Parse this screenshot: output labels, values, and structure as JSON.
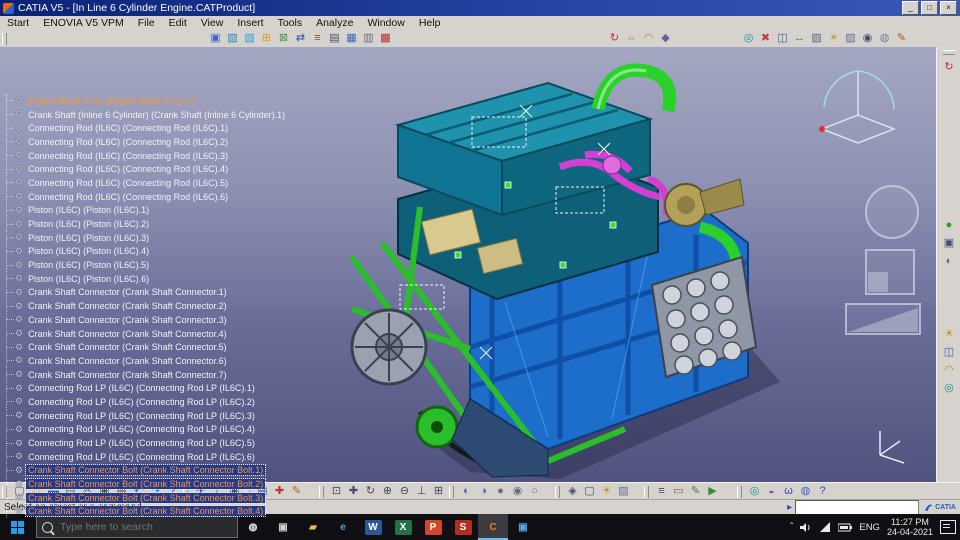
{
  "window": {
    "title": "CATIA V5 - [In Line 6 Cylinder Engine.CATProduct]",
    "controls": [
      {
        "name": "minimize-button",
        "glyph": "_"
      },
      {
        "name": "maximize-button",
        "glyph": "□"
      },
      {
        "name": "close-button",
        "glyph": "×"
      }
    ]
  },
  "menu": {
    "items": [
      "Start",
      "ENOVIA V5 VPM",
      "File",
      "Edit",
      "View",
      "Insert",
      "Tools",
      "Analyze",
      "Window",
      "Help"
    ]
  },
  "toolbar_top": {
    "group1": [
      {
        "name": "component-icon",
        "glyph": "▣",
        "color": "#3a66c8"
      },
      {
        "name": "product-icon",
        "glyph": "▧",
        "color": "#2f87c0"
      },
      {
        "name": "part-icon",
        "glyph": "▨",
        "color": "#2aa0d8"
      },
      {
        "name": "existing-component-icon",
        "glyph": "⊞",
        "color": "#d89a20"
      },
      {
        "name": "existing-component-positioned-icon",
        "glyph": "⊠",
        "color": "#3f9a40"
      },
      {
        "name": "replace-component-icon",
        "glyph": "⇄",
        "color": "#2850b8"
      },
      {
        "name": "graph-tree-reordering-icon",
        "glyph": "≡",
        "color": "#7a5a20"
      },
      {
        "name": "generate-numbering-icon",
        "glyph": "▤",
        "color": "#48506a"
      },
      {
        "name": "selective-load-icon",
        "glyph": "▦",
        "color": "#3a66c8"
      },
      {
        "name": "manage-representations-icon",
        "glyph": "▥",
        "color": "#6a7080"
      },
      {
        "name": "multi-instantiation-icon",
        "glyph": "▩",
        "color": "#b83030"
      }
    ],
    "group2": [
      {
        "name": "update-icon",
        "glyph": "↻",
        "color": "#c03030"
      },
      {
        "name": "measure-between-icon",
        "glyph": "⇔",
        "color": "#b08820"
      },
      {
        "name": "measure-item-icon",
        "glyph": "◠",
        "color": "#b08820"
      },
      {
        "name": "mass-properties-icon",
        "glyph": "◆",
        "color": "#705aa8"
      }
    ],
    "group3": [
      {
        "name": "catalog-browser-icon",
        "glyph": "◎",
        "color": "#17939b"
      },
      {
        "name": "clash-analysis-icon",
        "glyph": "✖",
        "color": "#c04040"
      },
      {
        "name": "sectioning-icon",
        "glyph": "◫",
        "color": "#4060b0"
      },
      {
        "name": "distance-band-icon",
        "glyph": "↔",
        "color": "#3a8a3a"
      },
      {
        "name": "camera-icon",
        "glyph": "▧",
        "color": "#606880"
      },
      {
        "name": "lighting-icon",
        "glyph": "☀",
        "color": "#c8a020"
      },
      {
        "name": "depth-effect-icon",
        "glyph": "▨",
        "color": "#607090"
      },
      {
        "name": "magnifier-icon",
        "glyph": "◉",
        "color": "#405068"
      },
      {
        "name": "x-ray-icon",
        "glyph": "◍",
        "color": "#708098"
      },
      {
        "name": "annotations-icon",
        "glyph": "✎",
        "color": "#b06020"
      }
    ]
  },
  "tree": {
    "items": [
      {
        "label": "Engine Block 6 Cy. (Engine Block 6 Cy..1)",
        "state": "orange"
      },
      {
        "label": "Crank Shaft (Inline 6 Cylinder) (Crank Shaft (Inline 6 Cylinder).1)",
        "state": "normal"
      },
      {
        "label": "Connecting Rod (IL6C) (Connecting Rod (IL6C).1)",
        "state": "normal"
      },
      {
        "label": "Connecting Rod (IL6C) (Connecting Rod (IL6C).2)",
        "state": "normal"
      },
      {
        "label": "Connecting Rod (IL6C) (Connecting Rod (IL6C).3)",
        "state": "normal"
      },
      {
        "label": "Connecting Rod (IL6C) (Connecting Rod (IL6C).4)",
        "state": "normal"
      },
      {
        "label": "Connecting Rod (IL6C) (Connecting Rod (IL6C).5)",
        "state": "normal"
      },
      {
        "label": "Connecting Rod (IL6C) (Connecting Rod (IL6C).6)",
        "state": "normal"
      },
      {
        "label": "Piston (IL6C) (Piston (IL6C).1)",
        "state": "normal"
      },
      {
        "label": "Piston (IL6C) (Piston (IL6C).2)",
        "state": "normal"
      },
      {
        "label": "Piston (IL6C) (Piston (IL6C).3)",
        "state": "normal"
      },
      {
        "label": "Piston (IL6C) (Piston (IL6C).4)",
        "state": "normal"
      },
      {
        "label": "Piston (IL6C) (Piston (IL6C).5)",
        "state": "normal"
      },
      {
        "label": "Piston (IL6C) (Piston (IL6C).6)",
        "state": "normal"
      },
      {
        "label": "Crank Shaft Connector (Crank Shaft Connector.1)",
        "state": "normal"
      },
      {
        "label": "Crank Shaft Connector (Crank Shaft Connector.2)",
        "state": "normal"
      },
      {
        "label": "Crank Shaft Connector (Crank Shaft Connector.3)",
        "state": "normal"
      },
      {
        "label": "Crank Shaft Connector (Crank Shaft Connector.4)",
        "state": "normal"
      },
      {
        "label": "Crank Shaft Connector (Crank Shaft Connector.5)",
        "state": "normal"
      },
      {
        "label": "Crank Shaft Connector (Crank Shaft Connector.6)",
        "state": "normal"
      },
      {
        "label": "Crank Shaft Connector (Crank Shaft Connector.7)",
        "state": "normal"
      },
      {
        "label": "Connecting Rod LP (IL6C) (Connecting Rod LP (IL6C).1)",
        "state": "normal"
      },
      {
        "label": "Connecting Rod LP (IL6C) (Connecting Rod LP (IL6C).2)",
        "state": "normal"
      },
      {
        "label": "Connecting Rod LP (IL6C) (Connecting Rod LP (IL6C).3)",
        "state": "normal"
      },
      {
        "label": "Connecting Rod LP (IL6C) (Connecting Rod LP (IL6C).4)",
        "state": "normal"
      },
      {
        "label": "Connecting Rod LP (IL6C) (Connecting Rod LP (IL6C).5)",
        "state": "normal"
      },
      {
        "label": "Connecting Rod LP (IL6C) (Connecting Rod LP (IL6C).6)",
        "state": "normal"
      },
      {
        "label": "Crank Shaft Connector Bolt (Crank Shaft Connector Bolt.1)",
        "state": "selected"
      },
      {
        "label": "Crank Shaft Connector Bolt (Crank Shaft Connector Bolt.2)",
        "state": "selected"
      },
      {
        "label": "Crank Shaft Connector Bolt (Crank Shaft Connector Bolt.3)",
        "state": "selected"
      },
      {
        "label": "Crank Shaft Connector Bolt (Crank Shaft Connector Bolt.4)",
        "state": "selected"
      }
    ]
  },
  "toolbar_bottom": {
    "groupA": [
      {
        "name": "new-document-icon",
        "glyph": "▢",
        "color": "#506080"
      },
      {
        "name": "open-icon",
        "glyph": "▱",
        "color": "#d8a020"
      },
      {
        "name": "save-icon",
        "glyph": "▬",
        "color": "#3050a0"
      },
      {
        "name": "print-icon",
        "glyph": "▤",
        "color": "#607080"
      },
      {
        "name": "cut-icon",
        "glyph": "✂",
        "color": "#505050"
      },
      {
        "name": "copy-icon",
        "glyph": "▣",
        "color": "#505050"
      },
      {
        "name": "paste-icon",
        "glyph": "▩",
        "color": "#7a5a30"
      },
      {
        "name": "undo-icon",
        "glyph": "↶",
        "color": "#2850b8"
      },
      {
        "name": "redo-icon",
        "glyph": "↷",
        "color": "#2850b8"
      },
      {
        "name": "help-icon",
        "glyph": "?",
        "color": "#2850b8"
      }
    ],
    "groupB": [
      {
        "name": "fly-mode-icon",
        "glyph": "✈",
        "color": "#3a5ac0"
      },
      {
        "name": "knowledge-fx-icon",
        "glyph": "ƒ",
        "color": "#987a18"
      },
      {
        "name": "search-icon",
        "glyph": "◉",
        "color": "#405068"
      }
    ],
    "groupC": [
      {
        "name": "grid-icon",
        "glyph": "▦",
        "color": "#3a66c8"
      },
      {
        "name": "axis-system-icon",
        "glyph": "✚",
        "color": "#c03030"
      },
      {
        "name": "sketcher-icon",
        "glyph": "✎",
        "color": "#b06020"
      }
    ],
    "groupD": [
      {
        "name": "fit-all-in-icon",
        "glyph": "⊡",
        "color": "#404a60"
      },
      {
        "name": "pan-icon",
        "glyph": "✚",
        "color": "#404a60"
      },
      {
        "name": "rotate-icon",
        "glyph": "↻",
        "color": "#404a60"
      },
      {
        "name": "zoom-in-icon",
        "glyph": "⊕",
        "color": "#404a60"
      },
      {
        "name": "zoom-out-icon",
        "glyph": "⊖",
        "color": "#404a60"
      },
      {
        "name": "normal-view-icon",
        "glyph": "⊥",
        "color": "#404a60"
      },
      {
        "name": "multi-view-icon",
        "glyph": "⊞",
        "color": "#404a60"
      }
    ],
    "groupE": [
      {
        "name": "hide-show-icon",
        "glyph": "◐",
        "color": "#3a66c8"
      },
      {
        "name": "swap-visible-space-icon",
        "glyph": "◑",
        "color": "#3a66c8"
      },
      {
        "name": "shading-icon",
        "glyph": "●",
        "color": "#607080"
      },
      {
        "name": "shading-edges-icon",
        "glyph": "◉",
        "color": "#607080"
      },
      {
        "name": "wireframe-icon",
        "glyph": "○",
        "color": "#607080"
      }
    ],
    "groupF": [
      {
        "name": "isometric-view-icon",
        "glyph": "◈",
        "color": "#405068"
      },
      {
        "name": "front-view-icon",
        "glyph": "▢",
        "color": "#405068"
      },
      {
        "name": "lighting-icon",
        "glyph": "☀",
        "color": "#c09020"
      },
      {
        "name": "depth-effect-icon",
        "glyph": "▨",
        "color": "#607090"
      }
    ],
    "groupG": [
      {
        "name": "layers-icon",
        "glyph": "≡",
        "color": "#404a60"
      },
      {
        "name": "ruler-icon",
        "glyph": "▭",
        "color": "#806030"
      },
      {
        "name": "painter-icon",
        "glyph": "✎",
        "color": "#3a8a3a"
      },
      {
        "name": "macro-play-icon",
        "glyph": "▶",
        "color": "#3a8a3a"
      }
    ],
    "groupH": [
      {
        "name": "catalog-icon",
        "glyph": "◎",
        "color": "#17939b"
      },
      {
        "name": "cache-icon",
        "glyph": "◒",
        "color": "#705aa8"
      },
      {
        "name": "knowledge-icon",
        "glyph": "ω",
        "color": "#2850b8"
      },
      {
        "name": "web-icon",
        "glyph": "◍",
        "color": "#3a66c8"
      },
      {
        "name": "whats-this-icon",
        "glyph": "?",
        "color": "#2850b8"
      }
    ]
  },
  "toolbar_right": {
    "top": [
      {
        "name": "update-icon",
        "glyph": "↻",
        "color": "#c03030"
      }
    ],
    "middle": [
      {
        "name": "apply-material-icon",
        "glyph": "●",
        "color": "#2aa02a"
      },
      {
        "name": "camera-icon",
        "glyph": "▣",
        "color": "#405068"
      },
      {
        "name": "render-icon",
        "glyph": "◐",
        "color": "#705aa8"
      }
    ],
    "bottom": [
      {
        "name": "light-icon",
        "glyph": "☀",
        "color": "#c09020"
      },
      {
        "name": "section-icon",
        "glyph": "◫",
        "color": "#4060b0"
      },
      {
        "name": "measure-icon",
        "glyph": "◠",
        "color": "#b08820"
      },
      {
        "name": "catalog-icon",
        "glyph": "◎",
        "color": "#17939b"
      }
    ]
  },
  "statusbar": {
    "message": "Select an object or a command",
    "power_input_value": "",
    "brand": "CATIA"
  },
  "taskbar": {
    "search_placeholder": "Type here to search",
    "apps": [
      {
        "name": "taskbar-cortana",
        "glyph": "◍",
        "bg": "transparent",
        "color": "#e8e8e8"
      },
      {
        "name": "taskbar-task-view",
        "glyph": "▣",
        "bg": "transparent",
        "color": "#d0d0d0"
      },
      {
        "name": "taskbar-file-explorer",
        "glyph": "▰",
        "bg": "transparent",
        "color": "#e8c23a"
      },
      {
        "name": "taskbar-edge",
        "glyph": "e",
        "bg": "transparent",
        "color": "#3ba7e0"
      },
      {
        "name": "taskbar-word",
        "glyph": "W",
        "bg": "#2b579a",
        "color": "#ffffff"
      },
      {
        "name": "taskbar-excel",
        "glyph": "X",
        "bg": "#217346",
        "color": "#ffffff"
      },
      {
        "name": "taskbar-powerpoint",
        "glyph": "P",
        "bg": "#d24726",
        "color": "#ffffff"
      },
      {
        "name": "taskbar-sql",
        "glyph": "S",
        "bg": "#b03020",
        "color": "#ffffff"
      },
      {
        "name": "taskbar-catia",
        "glyph": "C",
        "bg": "transparent",
        "color": "#ff7a20",
        "state": "active"
      },
      {
        "name": "taskbar-photos",
        "glyph": "▣",
        "bg": "transparent",
        "color": "#58a6e8"
      }
    ],
    "lang": "ENG",
    "time": "11:27 PM",
    "date": "24-04-2021"
  }
}
